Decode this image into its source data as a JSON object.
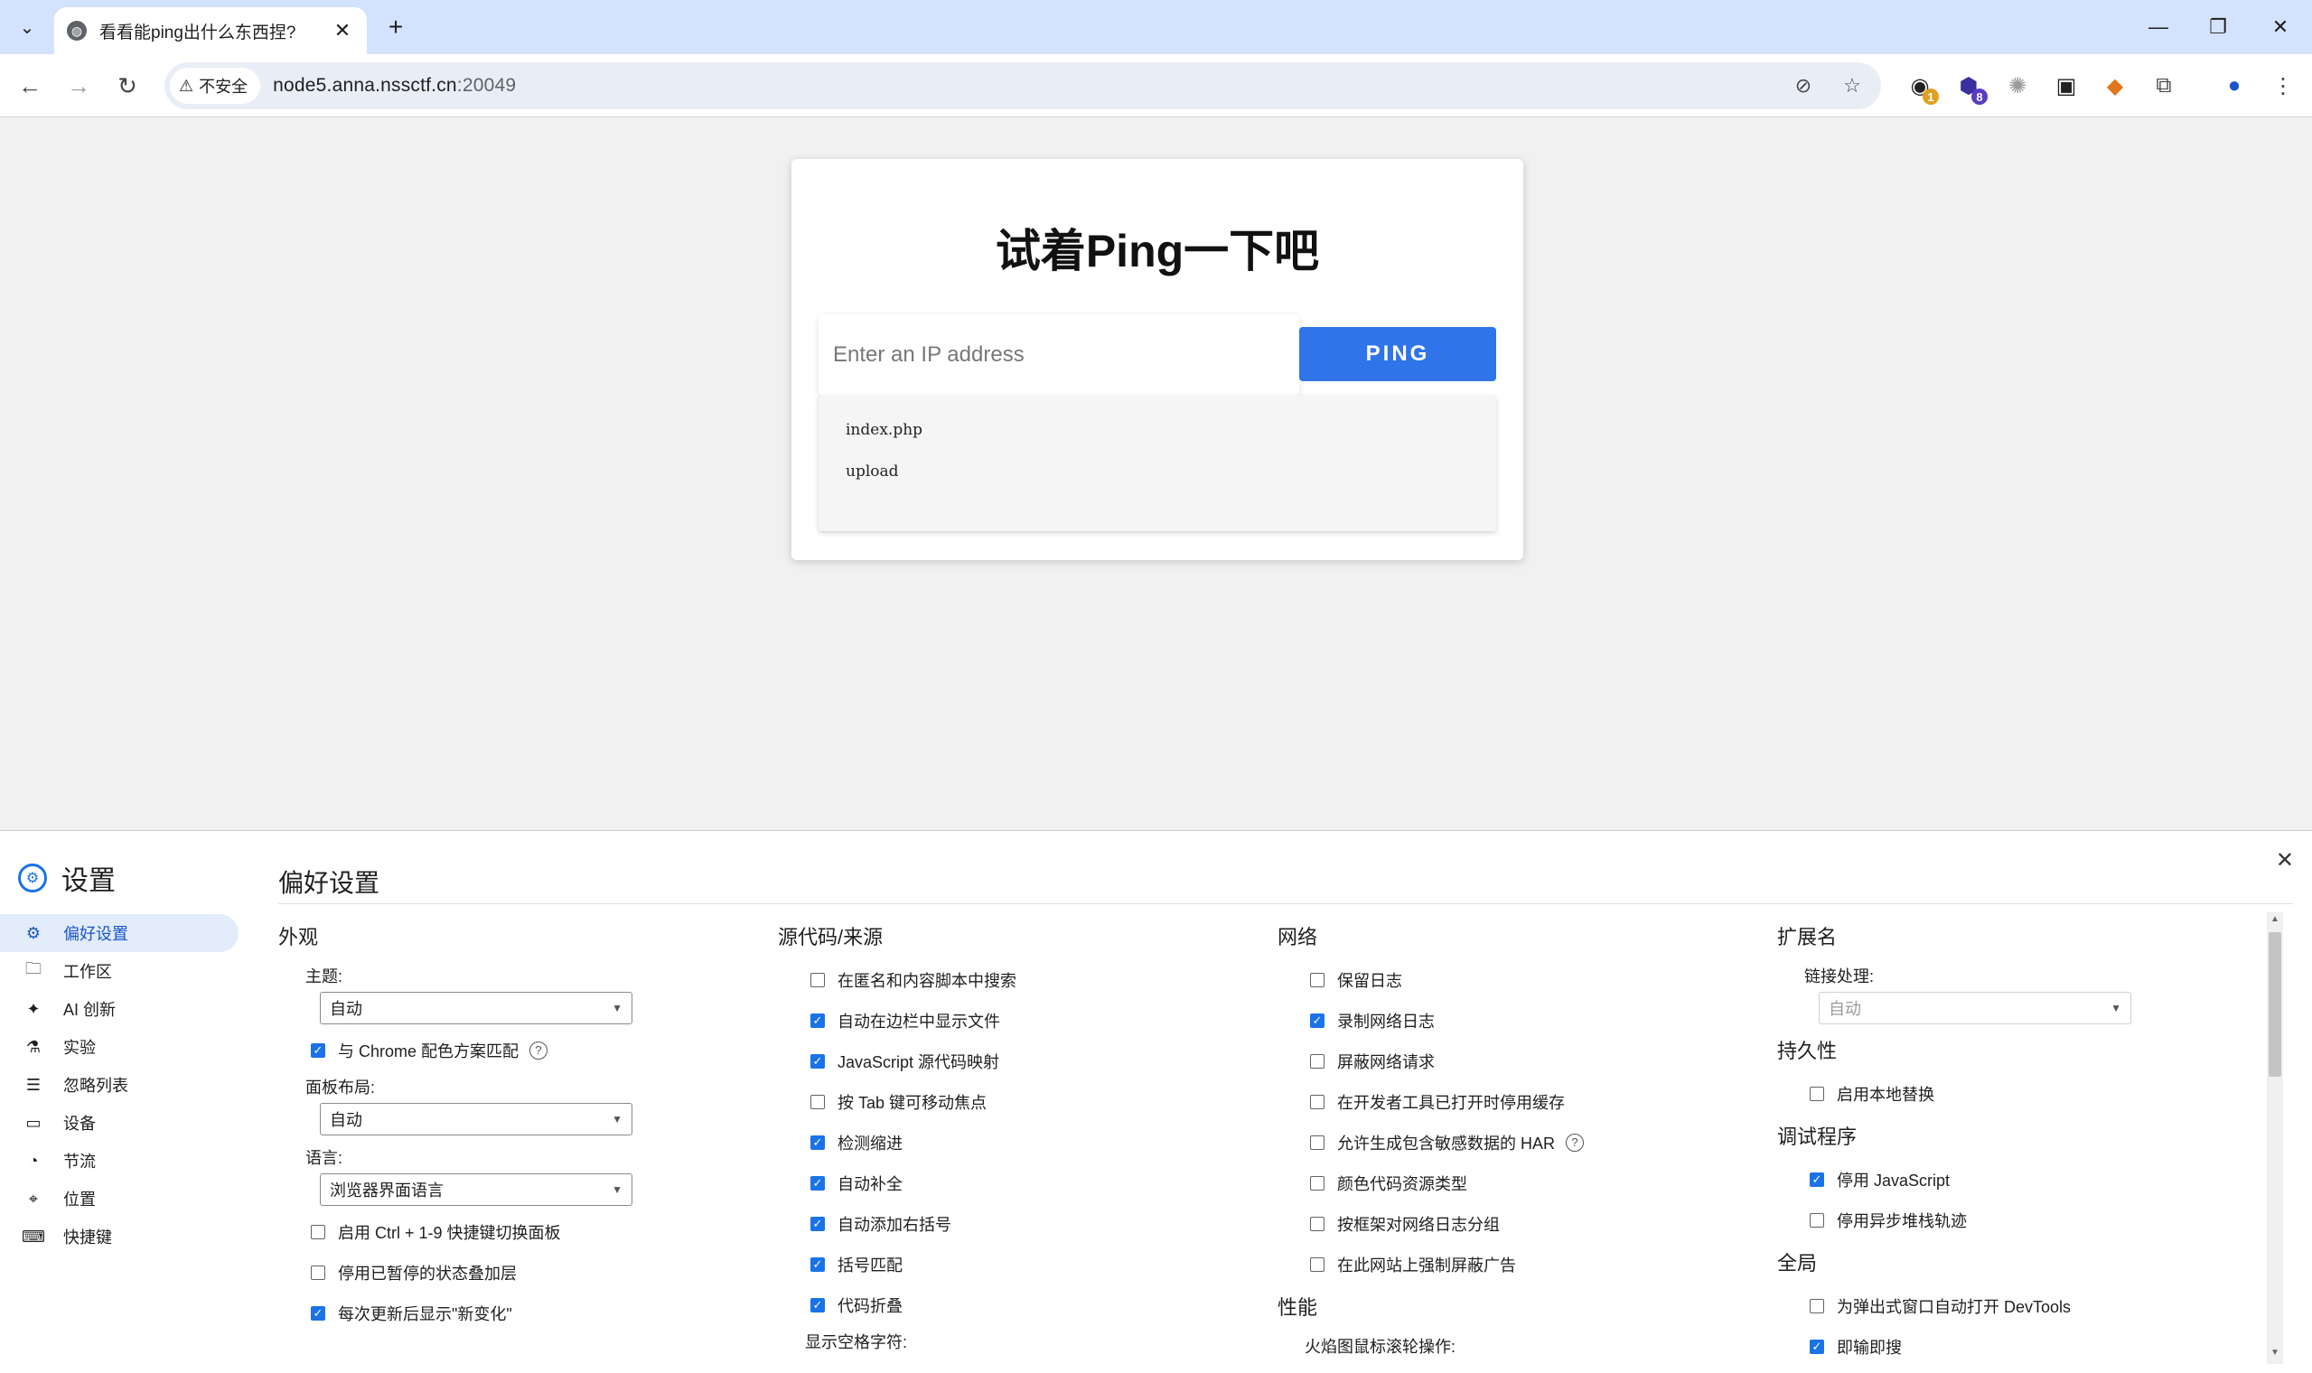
{
  "browser": {
    "tab_title": "看看能ping出什么东西捏?",
    "security_label": "不安全",
    "url_host": "node5.anna.nssctf.cn",
    "url_port": ":20049",
    "extension_badges": [
      "1",
      "8"
    ]
  },
  "page": {
    "heading": "试着Ping一下吧",
    "ip_placeholder": "Enter an IP address",
    "ping_button": "PING",
    "results": [
      "index.php",
      "upload"
    ]
  },
  "devtools": {
    "header_title": "设置",
    "main_title": "偏好设置",
    "nav": [
      {
        "label": "偏好设置",
        "icon": "gear-icon",
        "active": true
      },
      {
        "label": "工作区",
        "icon": "folder-icon",
        "active": false
      },
      {
        "label": "AI 创新",
        "icon": "sparkle-icon",
        "active": false
      },
      {
        "label": "实验",
        "icon": "flask-icon",
        "active": false
      },
      {
        "label": "忽略列表",
        "icon": "ignore-list-icon",
        "active": false
      },
      {
        "label": "设备",
        "icon": "devices-icon",
        "active": false
      },
      {
        "label": "节流",
        "icon": "speedometer-icon",
        "active": false
      },
      {
        "label": "位置",
        "icon": "location-pin-icon",
        "active": false
      },
      {
        "label": "快捷键",
        "icon": "keyboard-icon",
        "active": false
      }
    ],
    "appearance": {
      "title": "外观",
      "theme_label": "主题:",
      "theme_value": "自动",
      "match_chrome": "与 Chrome 配色方案匹配",
      "panel_layout_label": "面板布局:",
      "panel_layout_value": "自动",
      "language_label": "语言:",
      "language_value": "浏览器界面语言",
      "ctrl_switch": "启用 Ctrl + 1-9 快捷键切换面板",
      "disable_paused_overlay": "停用已暂停的状态叠加层",
      "show_whats_new": "每次更新后显示\"新变化\""
    },
    "sources": {
      "title": "源代码/来源",
      "items": [
        {
          "label": "在匿名和内容脚本中搜索",
          "checked": false
        },
        {
          "label": "自动在边栏中显示文件",
          "checked": true
        },
        {
          "label": "JavaScript 源代码映射",
          "checked": true
        },
        {
          "label": "按 Tab 键可移动焦点",
          "checked": false
        },
        {
          "label": "检测缩进",
          "checked": true
        },
        {
          "label": "自动补全",
          "checked": true
        },
        {
          "label": "自动添加右括号",
          "checked": true
        },
        {
          "label": "括号匹配",
          "checked": true
        },
        {
          "label": "代码折叠",
          "checked": true
        }
      ],
      "whitespace_label": "显示空格字符:"
    },
    "network": {
      "title": "网络",
      "items": [
        {
          "label": "保留日志",
          "checked": false
        },
        {
          "label": "录制网络日志",
          "checked": true
        },
        {
          "label": "屏蔽网络请求",
          "checked": false
        },
        {
          "label": "在开发者工具已打开时停用缓存",
          "checked": false
        },
        {
          "label": "允许生成包含敏感数据的 HAR",
          "checked": false
        },
        {
          "label": "颜色代码资源类型",
          "checked": false
        },
        {
          "label": "按框架对网络日志分组",
          "checked": false
        },
        {
          "label": "在此网站上强制屏蔽广告",
          "checked": false
        }
      ],
      "perf_title": "性能",
      "flamechart_label": "火焰图鼠标滚轮操作:"
    },
    "extensions": {
      "title": "扩展名",
      "link_handling_label": "链接处理:",
      "link_handling_value": "自动",
      "persistence_title": "持久性",
      "local_overrides": "启用本地替换",
      "debugger_title": "调试程序",
      "disable_js": "停用 JavaScript",
      "disable_async": "停用异步堆栈轨迹",
      "global_title": "全局",
      "auto_open_devtools": "为弹出式窗口自动打开 DevTools",
      "search_as_type": "即输即搜"
    },
    "colors": {
      "accent": "#1a73e8",
      "ping_button": "#2f74e8"
    }
  }
}
